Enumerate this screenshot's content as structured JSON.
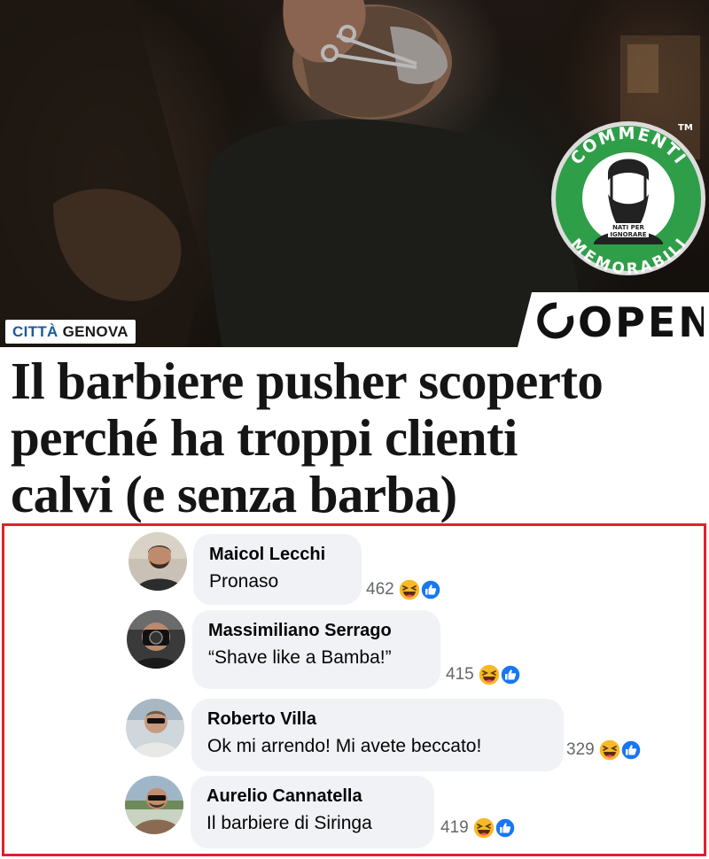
{
  "article": {
    "category_city": "CITTÀ",
    "category_place": "GENOVA",
    "headline_line1": "Il barbiere pusher scoperto",
    "headline_line2": "perché ha troppi clienti",
    "headline_line3": "calvi (e senza barba)"
  },
  "branding": {
    "publisher": "OPEN",
    "badge_top": "COMMENTI",
    "badge_bottom": "MEMORABILI",
    "badge_tagline_1": "NATI PER",
    "badge_tagline_2": "IGNORARE",
    "badge_tm": "TM"
  },
  "colors": {
    "frame": "#e1212d",
    "badge_green": "#2f9e48",
    "category_blue": "#1d5b9a",
    "bubble_bg": "#f0f2f5",
    "like_blue": "#1877f2",
    "haha_yellow": "#f7b928"
  },
  "comments": [
    {
      "author": "Maicol Lecchi",
      "text": "Pronaso",
      "reactions": "462",
      "reaction_icons": [
        "haha-icon",
        "like-icon"
      ]
    },
    {
      "author": "Massimiliano Serrago",
      "text": "“Shave like a Bamba!”",
      "reactions": "415",
      "reaction_icons": [
        "haha-icon",
        "like-icon"
      ]
    },
    {
      "author": "Roberto Villa",
      "text": "Ok mi arrendo! Mi avete beccato!",
      "reactions": "329",
      "reaction_icons": [
        "haha-icon",
        "like-icon"
      ]
    },
    {
      "author": "Aurelio Cannatella",
      "text": "Il barbiere di Siringa",
      "reactions": "419",
      "reaction_icons": [
        "haha-icon",
        "like-icon"
      ]
    }
  ]
}
